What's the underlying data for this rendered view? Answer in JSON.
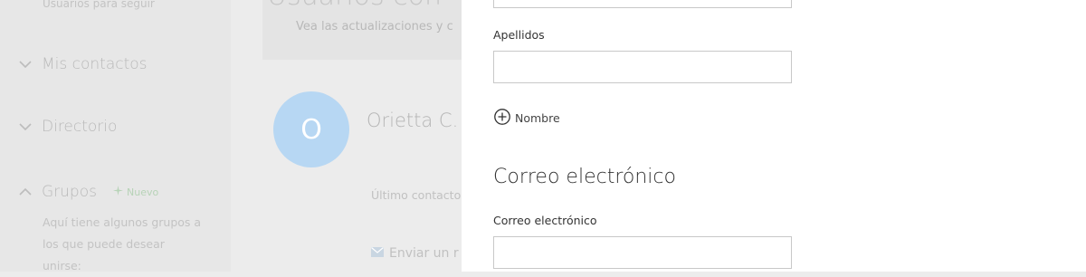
{
  "sidebar": {
    "following_sub": "Usuarios para seguir",
    "items": [
      {
        "label": "Mis contactos",
        "chevron": "chevron-down"
      },
      {
        "label": "Directorio",
        "chevron": "chevron-down"
      },
      {
        "label": "Grupos",
        "chevron": "chevron-up",
        "badge": "Nuevo"
      }
    ],
    "groups_desc": "Aquí tiene algunos grupos a los que puede desear unirse:"
  },
  "main": {
    "title": "Usuarios con",
    "subtitle": "Vea las actualizaciones y c",
    "contact": {
      "initial": "O",
      "name": "Orietta C."
    },
    "last_contact": "Último contacto",
    "send_message": "Enviar un r"
  },
  "panel": {
    "last_name_label": "Apellidos",
    "add_name_label": "Nombre",
    "email_section_title": "Correo electrónico",
    "email_label": "Correo electrónico",
    "first_name_value": "",
    "last_name_value": "",
    "email_value": ""
  },
  "colors": {
    "avatar": "#b7d7f3",
    "badge": "#9ccc9c",
    "panel": "#ffffff",
    "backdrop": "#ececec"
  }
}
